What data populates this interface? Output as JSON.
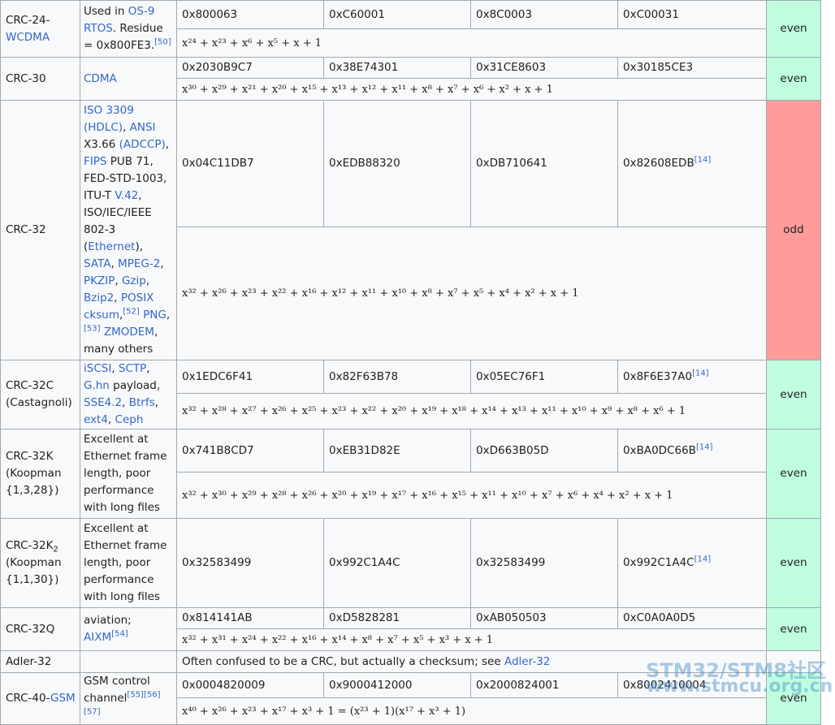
{
  "rows": [
    {
      "name": "CRC-24-WCDMA",
      "name_prefix": "CRC-24-",
      "name_link": "WCDMA",
      "use_parts": [
        "Used in ",
        "OS-9 RTOS",
        ". Residue = 0x800FE3."
      ],
      "use_ref": "[50]",
      "hex": [
        "0x800063",
        "0xC60001",
        "0x8C0003",
        "0xC00031"
      ],
      "poly": "x²⁴ + x²³ + x⁶ + x⁵ + x + 1",
      "parity": "even"
    },
    {
      "name": "CRC-30",
      "use_link": "CDMA",
      "hex": [
        "0x2030B9C7",
        "0x38E74301",
        "0x31CE8603",
        "0x30185CE3"
      ],
      "poly": "x³⁰ + x²⁹ + x²¹ + x²⁰ + x¹⁵ + x¹³ + x¹² + x¹¹ + x⁸ + x⁷ + x⁶ + x² + x + 1",
      "parity": "even"
    },
    {
      "name": "CRC-32",
      "use_html_parts": {
        "l1": "ISO 3309",
        "l2": "(HDLC)",
        "l3": "ANSI",
        "t1": " X3.66 ",
        "l4": "(ADCCP)",
        "t2": ", ",
        "l5": "FIPS",
        "t3": " PUB 71, FED-STD-1003, ITU-T ",
        "l6": "V.42",
        "t4": ", ISO/IEC/IEEE 802-3 (",
        "l7": "Ethernet",
        "t5": "), ",
        "l8": "SATA",
        "l9": "MPEG-2",
        "l10": "PKZIP",
        "l11": "Gzip",
        "l12": "Bzip2",
        "l13": "POSIX",
        "l14": "cksum",
        "r1": "[52]",
        "l15": "PNG",
        "r2": "[53]",
        "l16": "ZMODEM",
        "t6": ", many others"
      },
      "hex": [
        "0x04C11DB7",
        "0xEDB88320",
        "0xDB710641",
        "0x82608EDB"
      ],
      "hex_ref": "[14]",
      "poly": "x³² + x²⁶ + x²³ + x²² + x¹⁶ + x¹² + x¹¹ + x¹⁰ + x⁸ + x⁷ + x⁵ + x⁴ + x² + x + 1",
      "parity": "odd"
    },
    {
      "name": "CRC-32C",
      "name_sub": "(Castagnoli)",
      "use_links": [
        "iSCSI",
        "SCTP",
        "G.hn",
        "SSE4.2",
        "Btrfs",
        "ext4",
        "Ceph"
      ],
      "use_text": " payload, ",
      "hex": [
        "0x1EDC6F41",
        "0x82F63B78",
        "0x05EC76F1",
        "0x8F6E37A0"
      ],
      "hex_ref": "[14]",
      "poly": "x³² + x²⁸ + x²⁷ + x²⁶ + x²⁵ + x²³ + x²² + x²⁰ + x¹⁹ + x¹⁸ + x¹⁴ + x¹³ + x¹¹ + x¹⁰ + x⁹ + x⁸ + x⁶ + 1",
      "parity": "even"
    },
    {
      "name": "CRC-32K",
      "name_sub": "(Koopman {1,3,28})",
      "use": "Excellent at Ethernet frame length, poor performance with long files",
      "hex": [
        "0x741B8CD7",
        "0xEB31D82E",
        "0xD663B05D",
        "0xBA0DC66B"
      ],
      "hex_ref": "[14]",
      "poly": "x³² + x³⁰ + x²⁹ + x²⁸ + x²⁶ + x²⁰ + x¹⁹ + x¹⁷ + x¹⁶ + x¹⁵ + x¹¹ + x¹⁰ + x⁷ + x⁶ + x⁴ + x² + x + 1",
      "parity": "even"
    },
    {
      "name": "CRC-32K",
      "name_subscript": "2",
      "name_sub": "(Koopman {1,1,30})",
      "use": "Excellent at Ethernet frame length, poor performance with long files",
      "hex": [
        "0x32583499",
        "0x992C1A4C",
        "0x32583499",
        "0x992C1A4C"
      ],
      "hex_ref": "[14]",
      "parity": "even"
    },
    {
      "name": "CRC-32Q",
      "use_text": "aviation; ",
      "use_link": "AIXM",
      "use_ref": "[54]",
      "hex": [
        "0x814141AB",
        "0xD5828281",
        "0xAB050503",
        "0xC0A0A0D5"
      ],
      "poly": "x³² + x³¹ + x²⁴ + x²² + x¹⁶ + x¹⁴ + x⁸ + x⁷ + x⁵ + x³ + x + 1",
      "parity": "even"
    },
    {
      "name": "Adler-32",
      "note_text": "Often confused to be a CRC, but actually a checksum; see ",
      "note_link": "Adler-32"
    },
    {
      "name_prefix": "CRC-40-",
      "name_link": "GSM",
      "use_text": "GSM control channel",
      "use_refs": [
        "[55]",
        "[56]",
        "[57]"
      ],
      "hex": [
        "0x0004820009",
        "0x9000412000",
        "0x2000824001",
        "0x8002410004"
      ],
      "poly": "x⁴⁰ + x²⁶ + x²³ + x¹⁷ + x³ + 1 = (x²³ + 1)(x¹⁷ + x³ + 1)",
      "parity": "even"
    }
  ],
  "watermark": {
    "line1": "STM32/STM8社区",
    "line2": "www.stmcu.org.cn"
  }
}
